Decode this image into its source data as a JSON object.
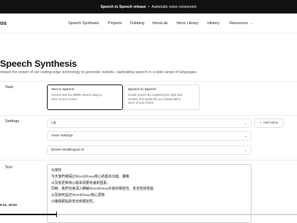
{
  "announcement": {
    "bold": "Speech to Speech release",
    "separator": "•",
    "text": "Automatic voice conversion"
  },
  "nav": {
    "logo": "os",
    "links": [
      "Speech Synthesis",
      "Projects",
      "Dubbing",
      "VoiceLab",
      "Voice Library",
      "History",
      "Resources"
    ],
    "chevron": "⌄"
  },
  "page": {
    "title": "Speech Synthesis",
    "subtitle": "nleash the power of our cutting-edge technology to generate realistic, captivating speech in a wide range of languages."
  },
  "task": {
    "label": "Task",
    "options": [
      {
        "title": "Text to Speech",
        "desc_line1": "Convert text into lifelike speech using a",
        "desc_line2": "voice of your choice.",
        "selected": true
      },
      {
        "title": "Speech to Speech",
        "desc_line1": "Create speech by combining the style and",
        "desc_line2": "content of an audio file you upload with a",
        "desc_line3": "voice of your choice.",
        "selected": false
      }
    ]
  },
  "settings": {
    "label": "Settings",
    "voice": "Lily",
    "voice_settings": "Voice Settings",
    "model": "Eleven Multilingual v2",
    "add_voice_icon": "+",
    "add_voice": "Add voice",
    "chevron": "⌄"
  },
  "text": {
    "label": "Text",
    "lines": [
      "大家好",
      "今天我們將探討WordPress核心的基本功能，策略",
      "以及有更新核心版本需要考慮的因素。",
      "同時，我們也會深入瞭解WordPress外掛的相容性，安全性和性能",
      "以及如何設定WordPress核心更新",
      "以確保網站的安全和穩定性。"
    ]
  },
  "video": {
    "timestamp": "9.23, 15:53",
    "progress": 0.19
  },
  "colors": {
    "accent": "#111111",
    "border": "#e3e3e3"
  }
}
